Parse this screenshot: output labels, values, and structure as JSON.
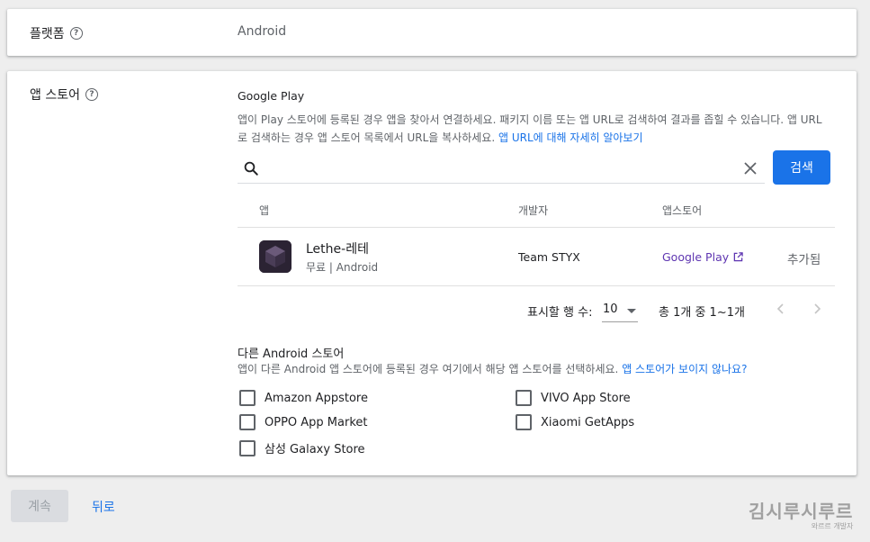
{
  "platform": {
    "label": "플랫폼",
    "value": "Android"
  },
  "app_store": {
    "label": "앱 스토어",
    "google_play_title": "Google Play",
    "description": "앱이 Play 스토어에 등록된 경우 앱을 찾아서 연결하세요. 패키지 이름 또는 앱 URL로 검색하여 결과를 좁힐 수 있습니다. 앱 URL로 검색하는 경우 앱 스토어 목록에서 URL을 복사하세요.",
    "learn_more": "앱 URL에 대해 자세히 알아보기",
    "search_value": "",
    "search_button": "검색",
    "columns": {
      "app": "앱",
      "developer": "개발자",
      "store": "앱스토어"
    },
    "results": [
      {
        "name": "Lethe-레테",
        "sub": "무료 | Android",
        "developer": "Team STYX",
        "store": "Google Play",
        "status": "추가됨"
      }
    ],
    "pager": {
      "rows_label": "표시할 행 수:",
      "rows_value": "10",
      "range": "총 1개 중 1~1개"
    }
  },
  "other_stores": {
    "title": "다른 Android 스토어",
    "description": "앱이 다른 Android 앱 스토어에 등록된 경우 여기에서 해당 앱 스토어를 선택하세요.",
    "help_link": "앱 스토어가 보이지 않나요?",
    "stores": [
      "Amazon Appstore",
      "VIVO App Store",
      "OPPO App Market",
      "Xiaomi GetApps",
      "삼성 Galaxy Store"
    ]
  },
  "footer": {
    "continue": "계속",
    "back": "뒤로"
  },
  "watermark": {
    "main": "김시루시루르",
    "sub": "와르르 개발자"
  },
  "colors": {
    "accent": "#1a73e8",
    "store_link": "#5e35b1",
    "background": "#eeeeee"
  }
}
